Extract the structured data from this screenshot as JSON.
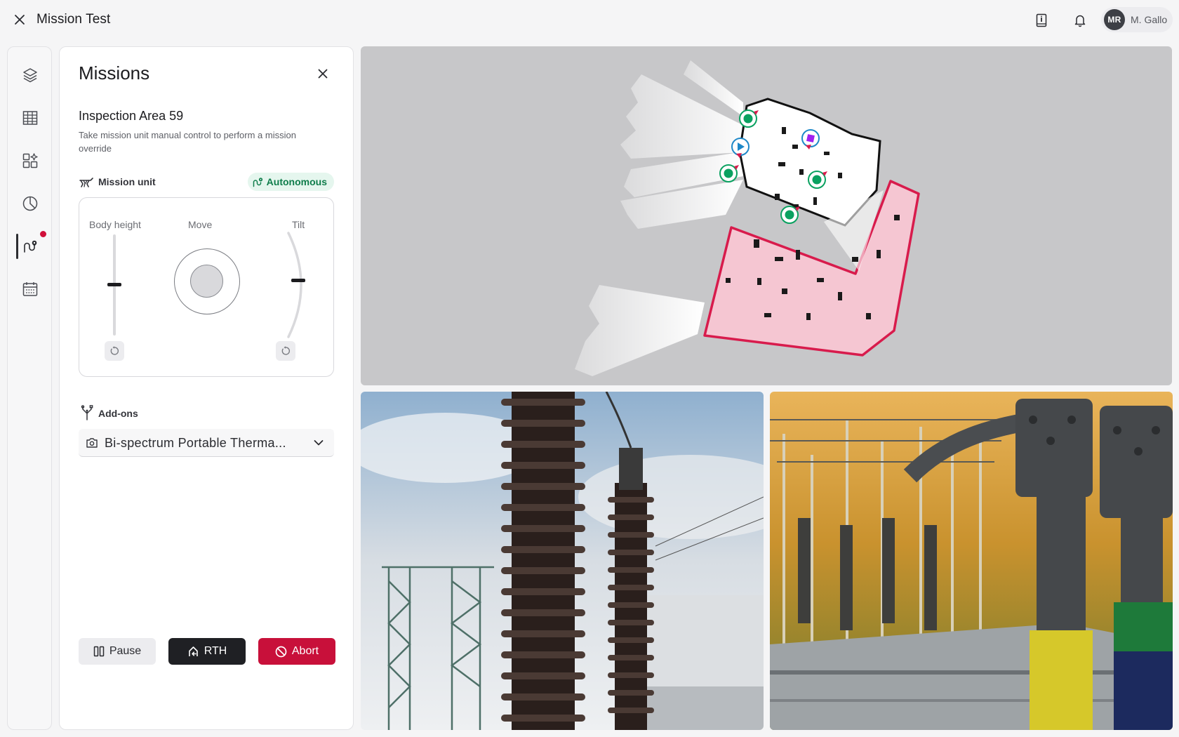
{
  "header": {
    "title": "Mission Test",
    "user_initials": "MR",
    "user_name": "M. Gallo"
  },
  "sidebar": {
    "items": [
      {
        "icon": "layers-icon"
      },
      {
        "icon": "table-icon"
      },
      {
        "icon": "widgets-icon"
      },
      {
        "icon": "pie-chart-icon"
      },
      {
        "icon": "mission-route-icon",
        "active": true,
        "has_notification": true
      },
      {
        "icon": "calendar-icon"
      }
    ]
  },
  "panel": {
    "title": "Missions",
    "mission_name": "Inspection Area 59",
    "description": "Take mission unit manual control to perform a mission override",
    "mission_unit_label": "Mission unit",
    "mode_badge": "Autonomous",
    "controls": {
      "body_height_label": "Body height",
      "move_label": "Move",
      "tilt_label": "Tilt"
    },
    "addons_label": "Add-ons",
    "addon_selected": "Bi-spectrum Portable Therma...",
    "buttons": {
      "pause": "Pause",
      "rth": "RTH",
      "abort": "Abort"
    }
  },
  "colors": {
    "accent_red": "#c8103a",
    "autonomous_green": "#0f7d4b",
    "waypoint_green": "#0aa160",
    "waypoint_blue": "#1e88c8",
    "poi_purple": "#a020f0",
    "zone_fill": "#f5c6d2"
  },
  "map": {
    "waypoints": 5,
    "zones": 2
  },
  "cameras": [
    {
      "icon": "substation-camera-feed-1"
    },
    {
      "icon": "substation-camera-feed-2"
    }
  ]
}
